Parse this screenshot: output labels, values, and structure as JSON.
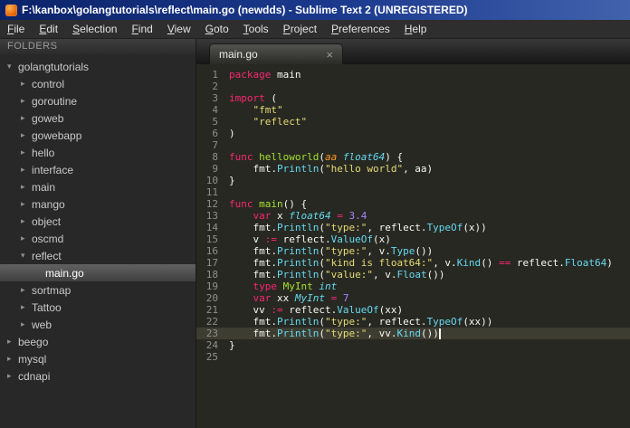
{
  "window": {
    "title": "F:\\kanbox\\golangtutorials\\reflect\\main.go (newdds) - Sublime Text 2 (UNREGISTERED)"
  },
  "menu": {
    "items": [
      "File",
      "Edit",
      "Selection",
      "Find",
      "View",
      "Goto",
      "Tools",
      "Project",
      "Preferences",
      "Help"
    ]
  },
  "sidebar": {
    "header": "FOLDERS",
    "tree": [
      {
        "label": "golangtutorials",
        "level": 0,
        "type": "folder",
        "expanded": true,
        "selected": false
      },
      {
        "label": "control",
        "level": 1,
        "type": "folder",
        "expanded": false,
        "selected": false
      },
      {
        "label": "goroutine",
        "level": 1,
        "type": "folder",
        "expanded": false,
        "selected": false
      },
      {
        "label": "goweb",
        "level": 1,
        "type": "folder",
        "expanded": false,
        "selected": false
      },
      {
        "label": "gowebapp",
        "level": 1,
        "type": "folder",
        "expanded": false,
        "selected": false
      },
      {
        "label": "hello",
        "level": 1,
        "type": "folder",
        "expanded": false,
        "selected": false
      },
      {
        "label": "interface",
        "level": 1,
        "type": "folder",
        "expanded": false,
        "selected": false
      },
      {
        "label": "main",
        "level": 1,
        "type": "folder",
        "expanded": false,
        "selected": false
      },
      {
        "label": "mango",
        "level": 1,
        "type": "folder",
        "expanded": false,
        "selected": false
      },
      {
        "label": "object",
        "level": 1,
        "type": "folder",
        "expanded": false,
        "selected": false
      },
      {
        "label": "oscmd",
        "level": 1,
        "type": "folder",
        "expanded": false,
        "selected": false
      },
      {
        "label": "reflect",
        "level": 1,
        "type": "folder",
        "expanded": true,
        "selected": false
      },
      {
        "label": "main.go",
        "level": 2,
        "type": "file",
        "expanded": false,
        "selected": true
      },
      {
        "label": "sortmap",
        "level": 1,
        "type": "folder",
        "expanded": false,
        "selected": false
      },
      {
        "label": "Tattoo",
        "level": 1,
        "type": "folder",
        "expanded": false,
        "selected": false
      },
      {
        "label": "web",
        "level": 1,
        "type": "folder",
        "expanded": false,
        "selected": false
      },
      {
        "label": "beego",
        "level": 0,
        "type": "folder",
        "expanded": false,
        "selected": false
      },
      {
        "label": "mysql",
        "level": 0,
        "type": "folder",
        "expanded": false,
        "selected": false
      },
      {
        "label": "cdnapi",
        "level": 0,
        "type": "folder",
        "expanded": false,
        "selected": false
      }
    ]
  },
  "tab": {
    "label": "main.go",
    "close": "×"
  },
  "editor": {
    "lines": [
      {
        "n": 1,
        "tokens": [
          [
            "package",
            "k"
          ],
          [
            " main",
            "p"
          ]
        ]
      },
      {
        "n": 2,
        "tokens": []
      },
      {
        "n": 3,
        "tokens": [
          [
            "import",
            "k"
          ],
          [
            " (",
            "p"
          ]
        ]
      },
      {
        "n": 4,
        "tokens": [
          [
            "    ",
            "p"
          ],
          [
            "\"fmt\"",
            "s"
          ]
        ]
      },
      {
        "n": 5,
        "tokens": [
          [
            "    ",
            "p"
          ],
          [
            "\"reflect\"",
            "s"
          ]
        ]
      },
      {
        "n": 6,
        "tokens": [
          [
            ")",
            "p"
          ]
        ]
      },
      {
        "n": 7,
        "tokens": []
      },
      {
        "n": 8,
        "tokens": [
          [
            "func",
            "k"
          ],
          [
            " ",
            "p"
          ],
          [
            "helloworld",
            "f"
          ],
          [
            "(",
            "p"
          ],
          [
            "aa",
            "a"
          ],
          [
            " ",
            "p"
          ],
          [
            "float64",
            "t"
          ],
          [
            ") {",
            "p"
          ]
        ]
      },
      {
        "n": 9,
        "tokens": [
          [
            "    fmt.",
            "p"
          ],
          [
            "Println",
            "c"
          ],
          [
            "(",
            "p"
          ],
          [
            "\"hello world\"",
            "s"
          ],
          [
            ", aa)",
            "p"
          ]
        ]
      },
      {
        "n": 10,
        "tokens": [
          [
            "}",
            "p"
          ]
        ]
      },
      {
        "n": 11,
        "tokens": []
      },
      {
        "n": 12,
        "tokens": [
          [
            "func",
            "k"
          ],
          [
            " ",
            "p"
          ],
          [
            "main",
            "f"
          ],
          [
            "() {",
            "p"
          ]
        ]
      },
      {
        "n": 13,
        "tokens": [
          [
            "    ",
            "p"
          ],
          [
            "var",
            "k"
          ],
          [
            " x ",
            "p"
          ],
          [
            "float64",
            "t"
          ],
          [
            " ",
            "p"
          ],
          [
            "=",
            "k"
          ],
          [
            " ",
            "p"
          ],
          [
            "3.4",
            "n"
          ]
        ]
      },
      {
        "n": 14,
        "tokens": [
          [
            "    fmt.",
            "p"
          ],
          [
            "Println",
            "c"
          ],
          [
            "(",
            "p"
          ],
          [
            "\"type:\"",
            "s"
          ],
          [
            ", reflect.",
            "p"
          ],
          [
            "TypeOf",
            "c"
          ],
          [
            "(x))",
            "p"
          ]
        ]
      },
      {
        "n": 15,
        "tokens": [
          [
            "    v ",
            "p"
          ],
          [
            ":=",
            "k"
          ],
          [
            " reflect.",
            "p"
          ],
          [
            "ValueOf",
            "c"
          ],
          [
            "(x)",
            "p"
          ]
        ]
      },
      {
        "n": 16,
        "tokens": [
          [
            "    fmt.",
            "p"
          ],
          [
            "Println",
            "c"
          ],
          [
            "(",
            "p"
          ],
          [
            "\"type:\"",
            "s"
          ],
          [
            ", v.",
            "p"
          ],
          [
            "Type",
            "c"
          ],
          [
            "())",
            "p"
          ]
        ]
      },
      {
        "n": 17,
        "tokens": [
          [
            "    fmt.",
            "p"
          ],
          [
            "Println",
            "c"
          ],
          [
            "(",
            "p"
          ],
          [
            "\"kind is float64:\"",
            "s"
          ],
          [
            ", v.",
            "p"
          ],
          [
            "Kind",
            "c"
          ],
          [
            "() ",
            "p"
          ],
          [
            "==",
            "k"
          ],
          [
            " reflect.",
            "p"
          ],
          [
            "Float64",
            "c"
          ],
          [
            ")",
            "p"
          ]
        ]
      },
      {
        "n": 18,
        "tokens": [
          [
            "    fmt.",
            "p"
          ],
          [
            "Println",
            "c"
          ],
          [
            "(",
            "p"
          ],
          [
            "\"value:\"",
            "s"
          ],
          [
            ", v.",
            "p"
          ],
          [
            "Float",
            "c"
          ],
          [
            "())",
            "p"
          ]
        ]
      },
      {
        "n": 19,
        "tokens": [
          [
            "    ",
            "p"
          ],
          [
            "type",
            "k"
          ],
          [
            " ",
            "p"
          ],
          [
            "MyInt",
            "f"
          ],
          [
            " ",
            "p"
          ],
          [
            "int",
            "t"
          ]
        ]
      },
      {
        "n": 20,
        "tokens": [
          [
            "    ",
            "p"
          ],
          [
            "var",
            "k"
          ],
          [
            " xx ",
            "p"
          ],
          [
            "MyInt",
            "t"
          ],
          [
            " ",
            "p"
          ],
          [
            "=",
            "k"
          ],
          [
            " ",
            "p"
          ],
          [
            "7",
            "n"
          ]
        ]
      },
      {
        "n": 21,
        "tokens": [
          [
            "    vv ",
            "p"
          ],
          [
            ":=",
            "k"
          ],
          [
            " reflect.",
            "p"
          ],
          [
            "ValueOf",
            "c"
          ],
          [
            "(xx)",
            "p"
          ]
        ]
      },
      {
        "n": 22,
        "tokens": [
          [
            "    fmt.",
            "p"
          ],
          [
            "Println",
            "c"
          ],
          [
            "(",
            "p"
          ],
          [
            "\"type:\"",
            "s"
          ],
          [
            ", reflect.",
            "p"
          ],
          [
            "TypeOf",
            "c"
          ],
          [
            "(xx))",
            "p"
          ]
        ]
      },
      {
        "n": 23,
        "tokens": [
          [
            "    fmt.",
            "p"
          ],
          [
            "Println",
            "c"
          ],
          [
            "(",
            "p"
          ],
          [
            "\"type:\"",
            "s"
          ],
          [
            ", vv.",
            "p"
          ],
          [
            "Kind",
            "c"
          ],
          [
            "())",
            "p"
          ]
        ],
        "current": true,
        "cursor": true
      },
      {
        "n": 24,
        "tokens": [
          [
            "}",
            "p"
          ]
        ]
      },
      {
        "n": 25,
        "tokens": []
      }
    ]
  },
  "colors": {
    "editor_background": "#272822",
    "line_highlight": "#3e3d32",
    "keyword": "#f92672",
    "string": "#e6db74",
    "function_name": "#a6e22e",
    "type": "#66d9ef",
    "number": "#ae81ff",
    "parameter": "#fd971f",
    "plain_text": "#f8f8f2",
    "line_number": "#8f908a",
    "titlebar_blue": "#0b2369",
    "app_icon_orange": "#e05a00"
  }
}
